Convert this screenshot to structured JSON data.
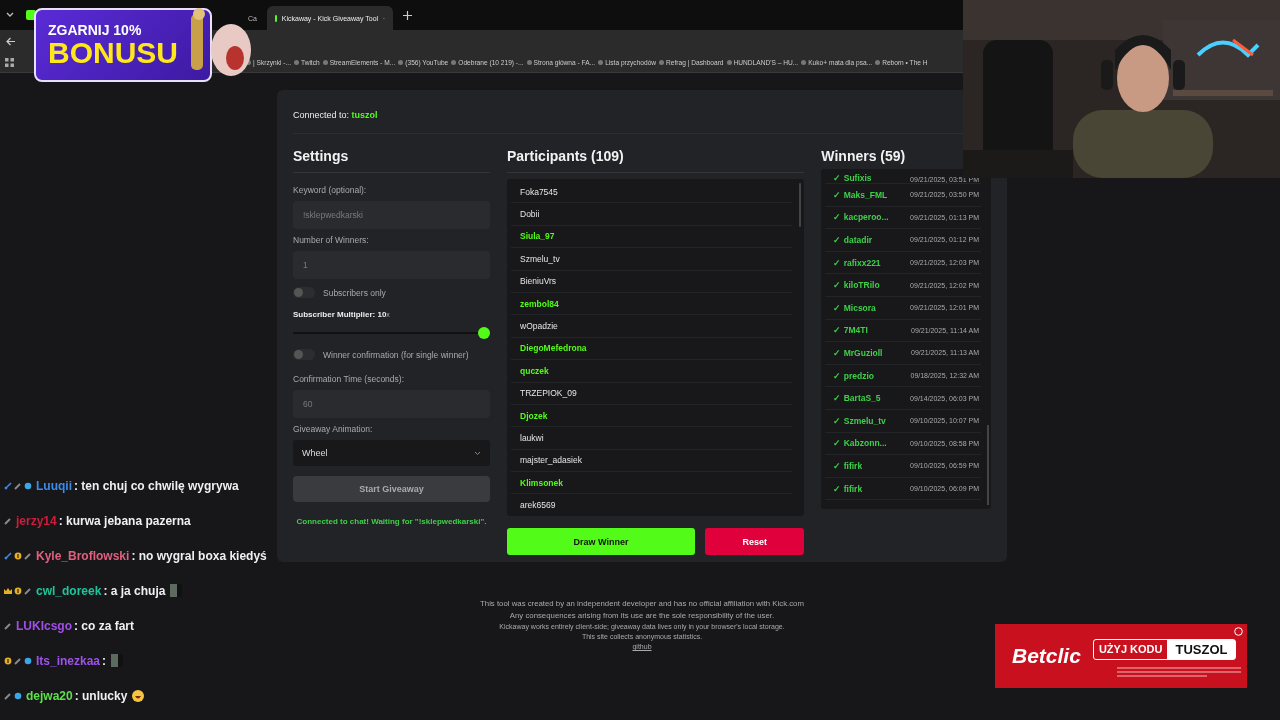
{
  "browser": {
    "tabs": [
      {
        "label": "Ca",
        "selected": false
      },
      {
        "label": "Kickaway - Kick Giveaway Tool",
        "selected": true
      }
    ],
    "bookmarks": [
      "| Skrzynki -...",
      "Twitch",
      "StreamElements - M...",
      "(356) YouTube",
      "Odebrane (10 219) -...",
      "Strona główna - FA...",
      "Lista przychodów",
      "Refrag | Dashboard",
      "HUNDLAND'S – HU...",
      "Kuko+ mata dla psa...",
      "Reborn • The H"
    ]
  },
  "promo": {
    "line_1": "ZGARNIJ 10%",
    "line_2": "BONUSU"
  },
  "app": {
    "connected_label": "Connected to:",
    "channel": "tuszol",
    "settings": {
      "title": "Settings",
      "keyword": {
        "label": "Keyword (optional):",
        "placeholder": "!sklepwedkarski"
      },
      "winners_count": {
        "label": "Number of Winners:",
        "placeholder": "1"
      },
      "subscribers_only": {
        "label": "Subscribers only",
        "on": false
      },
      "multiplier": {
        "label": "Subscriber Multiplier: 10",
        "suffix": "x",
        "level": 1
      },
      "confirmation": {
        "label": "Winner confirmation (for single winner)",
        "on": false
      },
      "confirmation_time": {
        "label": "Confirmation Time (seconds):",
        "placeholder": "60"
      },
      "animation": {
        "label": "Giveaway Animation:",
        "value": "Wheel"
      },
      "start_button": "Start Giveaway",
      "status": "Connected to chat! Waiting for \"!sklepwedkarski\"."
    },
    "participants": {
      "title": "Participants (109)",
      "items": [
        {
          "name": "Foka7545",
          "subscriber": false
        },
        {
          "name": "Dobii",
          "subscriber": false
        },
        {
          "name": "Siula_97",
          "subscriber": true
        },
        {
          "name": "Szmelu_tv",
          "subscriber": false
        },
        {
          "name": "BieniuVrs",
          "subscriber": false
        },
        {
          "name": "zembol84",
          "subscriber": true
        },
        {
          "name": "wOpadzie",
          "subscriber": false
        },
        {
          "name": "DiegoMefedrona",
          "subscriber": true
        },
        {
          "name": "quczek",
          "subscriber": true
        },
        {
          "name": "TRZEPIOK_09",
          "subscriber": false
        },
        {
          "name": "Djozek",
          "subscriber": true
        },
        {
          "name": "laukwi",
          "subscriber": false
        },
        {
          "name": "majster_adasiek",
          "subscriber": false
        },
        {
          "name": "Klimsonek",
          "subscriber": true
        },
        {
          "name": "arek6569",
          "subscriber": false
        }
      ],
      "draw_button": "Draw Winner",
      "reset_button": "Reset"
    },
    "winners": {
      "title": "Winners (59)",
      "items": [
        {
          "mark": "✓",
          "name": "Sufixis",
          "time": "09/21/2025, 03:51 PM"
        },
        {
          "mark": "✓",
          "name": "Maks_FML",
          "time": "09/21/2025, 03:50 PM"
        },
        {
          "mark": "✓",
          "name": "kacperoo...",
          "time": "09/21/2025, 01:13 PM"
        },
        {
          "mark": "✓",
          "name": "datadir",
          "time": "09/21/2025, 01:12 PM"
        },
        {
          "mark": "✓",
          "name": "rafixx221",
          "time": "09/21/2025, 12:03 PM"
        },
        {
          "mark": "✓",
          "name": "kiloTRilo",
          "time": "09/21/2025, 12:02 PM"
        },
        {
          "mark": "✓",
          "name": "Micsora",
          "time": "09/21/2025, 12:01 PM"
        },
        {
          "mark": "✓",
          "name": "7M4TI",
          "time": "09/21/2025, 11:14 AM"
        },
        {
          "mark": "✓",
          "name": "MrGuzioll",
          "time": "09/21/2025, 11:13 AM"
        },
        {
          "mark": "✓",
          "name": "predzio",
          "time": "09/18/2025, 12:32 AM"
        },
        {
          "mark": "✓",
          "name": "BartaS_5",
          "time": "09/14/2025, 06:03 PM"
        },
        {
          "mark": "✓",
          "name": "Szmelu_tv",
          "time": "09/10/2025, 10:07 PM"
        },
        {
          "mark": "✓",
          "name": "Kabzonn...",
          "time": "09/10/2025, 08:58 PM"
        },
        {
          "mark": "✓",
          "name": "fifirk",
          "time": "09/10/2025, 06:59 PM"
        },
        {
          "mark": "✓",
          "name": "fifirk",
          "time": "09/10/2025, 06:09 PM"
        }
      ]
    }
  },
  "footer": {
    "lines": [
      "This tool was created by an independent developer and has no official affiliation with Kick.com",
      "Any consequences arising from its use are the sole responsibility of the user.",
      "Kickaway works entirely client-side; giveaway data lives only in your browser's local storage.",
      "This site collects anonymous statistics."
    ],
    "link": "github"
  },
  "chat": [
    {
      "user": "Luuqii",
      "color": "#3b8be8",
      "badges": [
        {
          "kind": "sword"
        },
        {
          "kind": "pen"
        },
        {
          "kind": "gem"
        }
      ],
      "text": ": ten chuj co chwilę wygrywa"
    },
    {
      "user": "jerzy14",
      "color": "#d01c3c",
      "badges": [
        {
          "kind": "pen"
        }
      ],
      "text": ": kurwa jebana pazerna"
    },
    {
      "user": "Kyle_Broflowski",
      "color": "#e0607e",
      "badges": [
        {
          "kind": "sword"
        },
        {
          "kind": "coin"
        },
        {
          "kind": "pen"
        }
      ],
      "text": ": no wygral boxa kiedyś"
    },
    {
      "user": "cwl_doreek",
      "color": "#22c39a",
      "badges": [
        {
          "kind": "crown"
        },
        {
          "kind": "coin"
        },
        {
          "kind": "pen"
        }
      ],
      "text": ": a ja chuja",
      "emote": {
        "kind": "sticker"
      }
    },
    {
      "user": "LUKIcsgo",
      "color": "#a24ee8",
      "badges": [
        {
          "kind": "pen"
        }
      ],
      "text": ": co za fart"
    },
    {
      "user": "Its_inezkaa",
      "color": "#9d52ea",
      "badges": [
        {
          "kind": "coin"
        },
        {
          "kind": "pen"
        },
        {
          "kind": "gem"
        }
      ],
      "text": ":",
      "emote": {
        "kind": "sticker"
      }
    },
    {
      "user": "dejwa20",
      "color": "#5de04a",
      "badges": [
        {
          "kind": "pen"
        },
        {
          "kind": "gem"
        }
      ],
      "text": ": unlucky",
      "emote": {
        "kind": "laugh"
      }
    }
  ],
  "ad": {
    "brand": "Betclic",
    "code_label": "UŻYJ KODU",
    "code": "TUSZOL"
  }
}
